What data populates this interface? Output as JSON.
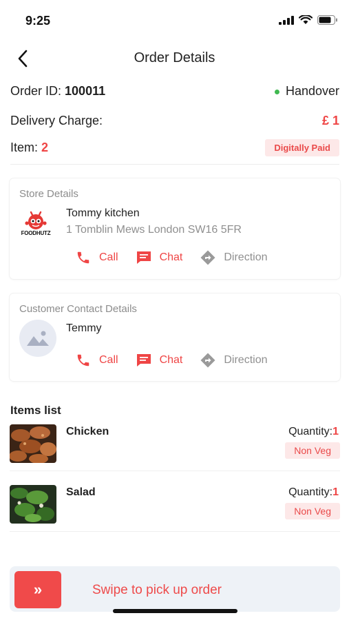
{
  "status": {
    "time": "9:25"
  },
  "header": {
    "title": "Order Details"
  },
  "order": {
    "id_label": "Order ID:",
    "id_value": "100011",
    "status": "Handover",
    "delivery_label": "Delivery Charge:",
    "delivery_value": "£ 1",
    "item_label": "Item:",
    "item_count": "2",
    "payment_badge": "Digitally Paid"
  },
  "store": {
    "section_title": "Store Details",
    "logo_text": "FOODHUTZ",
    "name": "Tommy kitchen",
    "address": "1 Tomblin Mews London SW16 5FR",
    "call": "Call",
    "chat": "Chat",
    "direction": "Direction"
  },
  "customer": {
    "section_title": "Customer Contact Details",
    "name": "Temmy",
    "call": "Call",
    "chat": "Chat",
    "direction": "Direction"
  },
  "items": {
    "title": "Items list",
    "quantity_label": "Quantity:",
    "list": [
      {
        "name": "Chicken",
        "quantity": "1",
        "tag": "Non Veg"
      },
      {
        "name": "Salad",
        "quantity": "1",
        "tag": "Non Veg"
      }
    ]
  },
  "swipe": {
    "knob": "»",
    "label": "Swipe to pick up order"
  },
  "colors": {
    "accent": "#ef4545",
    "status_dot": "#3fb950",
    "badge_bg": "#fde8e8"
  }
}
